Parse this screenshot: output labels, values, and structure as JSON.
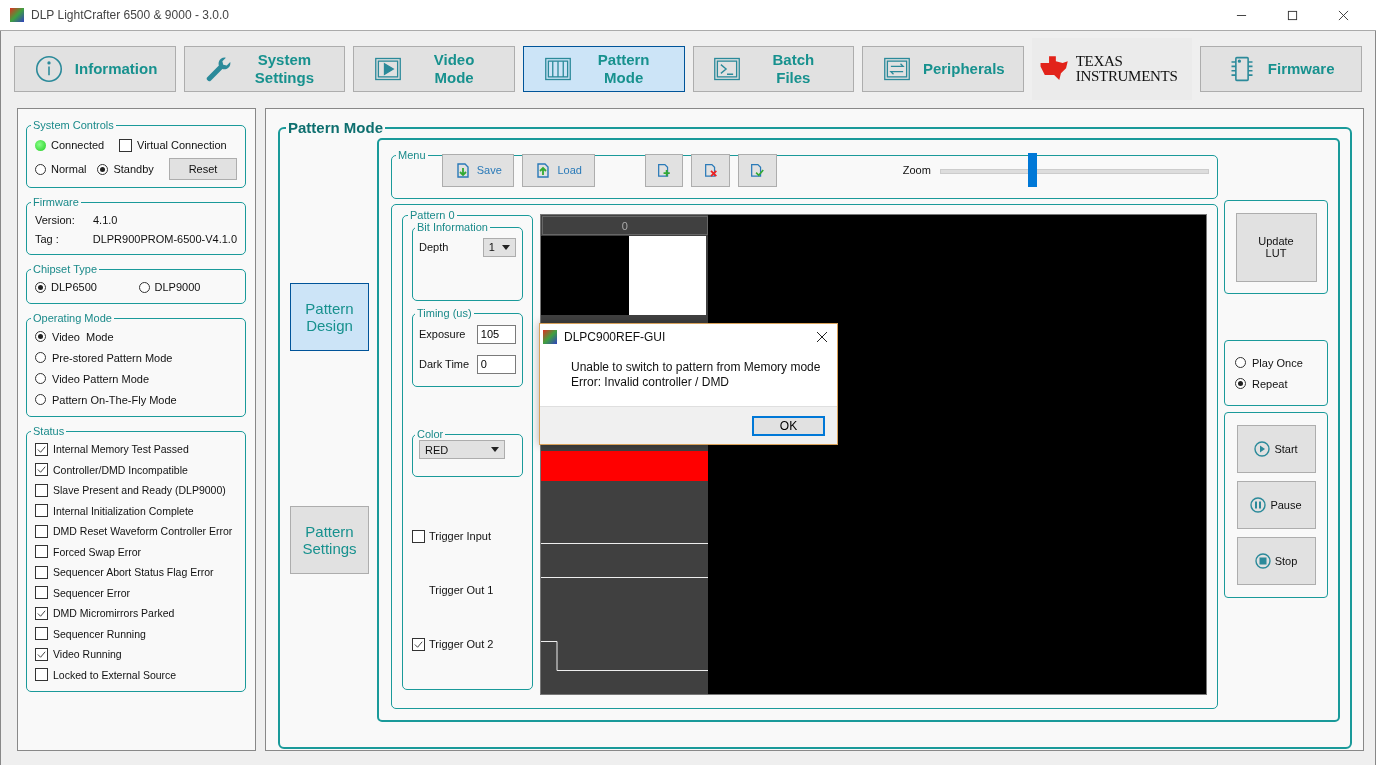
{
  "window": {
    "title": "DLP LightCrafter 6500 & 9000 - 3.0.0"
  },
  "tabs": [
    {
      "label": "Information",
      "selected": false
    },
    {
      "label": "System Settings",
      "selected": false
    },
    {
      "label": "Video Mode",
      "selected": false
    },
    {
      "label": "Pattern Mode",
      "selected": true
    },
    {
      "label": "Batch Files",
      "selected": false
    },
    {
      "label": "Peripherals",
      "selected": false
    },
    {
      "label": "Firmware",
      "selected": false
    }
  ],
  "logo": {
    "line1": "TEXAS",
    "line2": "INSTRUMENTS"
  },
  "system_controls": {
    "title": "System Controls",
    "connected": {
      "label": "Connected",
      "on": true
    },
    "virtual": {
      "label": "Virtual Connection",
      "checked": false
    },
    "modes": [
      {
        "label": "Normal",
        "selected": false
      },
      {
        "label": "Standby",
        "selected": true
      }
    ],
    "reset": "Reset"
  },
  "firmware": {
    "title": "Firmware",
    "rows": [
      {
        "label": "Version:",
        "value": "4.1.0"
      },
      {
        "label": "Tag :",
        "value": "DLPR900PROM-6500-V4.1.0"
      }
    ]
  },
  "chipset": {
    "title": "Chipset Type",
    "options": [
      {
        "label": "DLP6500",
        "selected": true
      },
      {
        "label": "DLP9000",
        "selected": false
      }
    ]
  },
  "operating_mode": {
    "title": "Operating Mode",
    "options": [
      {
        "label": "Video  Mode",
        "selected": true
      },
      {
        "label": "Pre-stored Pattern Mode",
        "selected": false
      },
      {
        "label": "Video Pattern Mode",
        "selected": false
      },
      {
        "label": "Pattern On-The-Fly Mode",
        "selected": false
      }
    ]
  },
  "status": {
    "title": "Status",
    "items": [
      {
        "label": "Internal Memory Test Passed",
        "checked": true
      },
      {
        "label": "Controller/DMD Incompatible",
        "checked": true
      },
      {
        "label": "Slave Present and Ready (DLP9000)",
        "checked": false
      },
      {
        "label": "Internal Initialization Complete",
        "checked": false
      },
      {
        "label": "DMD Reset Waveform Controller Error",
        "checked": false
      },
      {
        "label": "Forced Swap Error",
        "checked": false
      },
      {
        "label": "Sequencer Abort Status Flag Error",
        "checked": false
      },
      {
        "label": "Sequencer Error",
        "checked": false
      },
      {
        "label": "DMD Micromirrors Parked",
        "checked": true
      },
      {
        "label": "Sequencer Running",
        "checked": false
      },
      {
        "label": "Video Running",
        "checked": true
      },
      {
        "label": "Locked to External Source",
        "checked": false
      }
    ]
  },
  "pattern_mode": {
    "title": "Pattern Mode",
    "side_buttons": [
      {
        "label": "Pattern Design",
        "selected": true
      },
      {
        "label": "Pattern Settings",
        "selected": false
      }
    ],
    "menu": {
      "title": "Menu",
      "buttons": [
        {
          "label": "Save"
        },
        {
          "label": "Load"
        }
      ],
      "zoom": {
        "label": "Zoom",
        "level": 0.34
      }
    },
    "pattern": {
      "title": "Pattern 0",
      "bit_info": {
        "title": "Bit Information",
        "depth_label": "Depth",
        "depth": "1"
      },
      "timing": {
        "title": "Timing (us)",
        "exposure_label": "Exposure",
        "exposure": "105",
        "dark_label": "Dark Time",
        "dark": "0"
      },
      "color": {
        "title": "Color",
        "value": "RED"
      },
      "triggers": [
        {
          "label": "Trigger Input",
          "kind": "checkbox",
          "checked": false
        },
        {
          "label": "Trigger Out 1",
          "kind": "plain"
        },
        {
          "label": "Trigger Out 2",
          "kind": "checkbox",
          "checked": true
        }
      ]
    },
    "preview": {
      "header": "0"
    },
    "update": "Update LUT",
    "playback": [
      {
        "label": "Play Once",
        "selected": false
      },
      {
        "label": "Repeat",
        "selected": true
      }
    ],
    "controls": [
      {
        "label": "Start"
      },
      {
        "label": "Pause"
      },
      {
        "label": "Stop"
      }
    ]
  },
  "dialog": {
    "title": "DLPC900REF-GUI",
    "lines": [
      "Unable to switch to pattern from Memory mode",
      "Error: Invalid controller / DMD"
    ],
    "button": "OK"
  }
}
